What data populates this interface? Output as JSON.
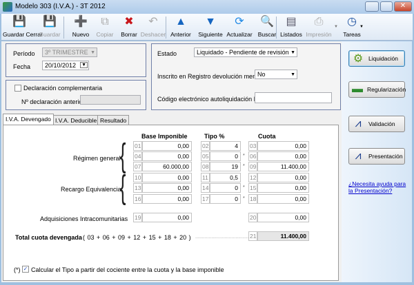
{
  "window": {
    "title": "Modelo 303 (I.V.A.) - 3T 2012"
  },
  "toolbar": [
    {
      "label": "Guardar Cerrar",
      "icon": "save-close-icon",
      "glyph": "💾",
      "enabled": true
    },
    {
      "label": "Guardar",
      "icon": "save-icon",
      "glyph": "💾",
      "enabled": false
    },
    {
      "label": "Nuevo",
      "icon": "new-icon",
      "glyph": "➕",
      "enabled": true
    },
    {
      "label": "Copiar",
      "icon": "copy-icon",
      "glyph": "⧉",
      "enabled": false
    },
    {
      "label": "Borrar",
      "icon": "delete-icon",
      "glyph": "✖",
      "enabled": true
    },
    {
      "label": "Deshacer",
      "icon": "undo-icon",
      "glyph": "↶",
      "enabled": false
    },
    {
      "label": "Anterior",
      "icon": "arrow-up-icon",
      "glyph": "▲",
      "enabled": true
    },
    {
      "label": "Siguiente",
      "icon": "arrow-down-icon",
      "glyph": "▼",
      "enabled": true
    },
    {
      "label": "Actualizar",
      "icon": "refresh-icon",
      "glyph": "⟳",
      "enabled": true
    },
    {
      "label": "Buscar",
      "icon": "search-icon",
      "glyph": "🔍",
      "enabled": true
    },
    {
      "label": "Listados",
      "icon": "reports-icon",
      "glyph": "▤",
      "enabled": true
    },
    {
      "label": "Impresión",
      "icon": "printer-icon",
      "glyph": "⎙",
      "enabled": false
    },
    {
      "label": "Tareas",
      "icon": "clock-icon",
      "glyph": "◷",
      "enabled": true
    }
  ],
  "header": {
    "periodo_label": "Período",
    "periodo_value": "3º TRIMESTRE",
    "fecha_label": "Fecha",
    "fecha_value": "20/10/2012",
    "complementaria_label": "Declaración complementaria",
    "complementaria_checked": false,
    "num_anterior_label": "Nº declaración anterior",
    "num_anterior_value": "",
    "estado_label": "Estado",
    "estado_value": "Liquidado - Pendiente de revisión",
    "registro_label": "Inscrito en Registro devolución mensual",
    "registro_value": "No",
    "codigo_label": "Código electrónico autoliquidación IVA",
    "codigo_value": ""
  },
  "tabs": [
    {
      "label": "I.V.A. Devengado",
      "active": true
    },
    {
      "label": "I.V.A. Deducible"
    },
    {
      "label": "Resultado"
    }
  ],
  "table": {
    "headers": [
      "Base Imponible",
      "Tipo %",
      "Cuota"
    ],
    "groups": [
      {
        "label": "Régimen general"
      },
      {
        "label": "Recargo Equivalencia"
      }
    ],
    "rows": [
      {
        "c1": "01",
        "base": "0,00",
        "c2": "02",
        "tipo": "4",
        "ast": "",
        "c3": "03",
        "cuota": "0,00"
      },
      {
        "c1": "04",
        "base": "0,00",
        "c2": "05",
        "tipo": "0",
        "ast": "*",
        "c3": "06",
        "cuota": "0,00"
      },
      {
        "c1": "07",
        "base": "60.000,00",
        "c2": "08",
        "tipo": "19",
        "ast": "*",
        "c3": "09",
        "cuota": "11.400,00"
      },
      {
        "c1": "10",
        "base": "0,00",
        "c2": "11",
        "tipo": "0,5",
        "ast": "",
        "c3": "12",
        "cuota": "0,00"
      },
      {
        "c1": "13",
        "base": "0,00",
        "c2": "14",
        "tipo": "0",
        "ast": "*",
        "c3": "15",
        "cuota": "0,00"
      },
      {
        "c1": "16",
        "base": "0,00",
        "c2": "17",
        "tipo": "0",
        "ast": "*",
        "c3": "18",
        "cuota": "0,00"
      }
    ],
    "adq": {
      "label": "Adquisiciones Intracomunitarias",
      "c1": "19",
      "base": "0,00",
      "c3": "20",
      "cuota": "0,00"
    },
    "total": {
      "label": "Total cuota devengada",
      "formula": "( 03 + 06 + 09 + 12 + 15 + 18 + 20 )",
      "dots": "............................................",
      "code": "21",
      "value": "11.400,00"
    },
    "footnote": {
      "mark": "(*)",
      "label": "Calcular el Tipo a partir del cociente entre la cuota y la base imponible",
      "checked": true
    }
  },
  "side": {
    "buttons": [
      {
        "label": "Liquidación",
        "icon": "gear-icon",
        "glyph": "⚙",
        "color": "#5a9a1a"
      },
      {
        "label": "Regularización",
        "icon": "book-icon",
        "glyph": "▬",
        "color": "#2e8b2e"
      },
      {
        "label": "Validación",
        "icon": "aeat-logo-icon",
        "glyph": "⩘",
        "color": "#1a3c8c"
      },
      {
        "label": "Presentación",
        "icon": "aeat-logo-icon",
        "glyph": "⩘",
        "color": "#1a3c8c"
      }
    ],
    "help_link": "¿Necesita ayuda para la Presentación?"
  }
}
